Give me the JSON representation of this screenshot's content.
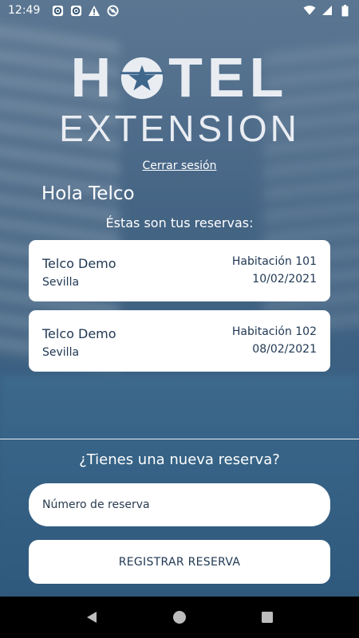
{
  "status_bar": {
    "time": "12:49",
    "left_icons": [
      "notification-icon",
      "notification-icon",
      "alert-icon",
      "do-not-disturb-icon"
    ],
    "right_icons": [
      "wifi-icon",
      "signal-icon",
      "battery-icon"
    ]
  },
  "logo": {
    "line1_part1": "H",
    "line1_part2": "TEL",
    "line2": "EXTENSION",
    "icon": "star-icon"
  },
  "logout_label": "Cerrar sesión",
  "greeting": "Hola Telco",
  "subtitle": "Éstas son tus reservas:",
  "reservations": [
    {
      "name": "Telco Demo",
      "city": "Sevilla",
      "room": "Habitación 101",
      "date": "10/02/2021"
    },
    {
      "name": "Telco Demo",
      "city": "Sevilla",
      "room": "Habitación 102",
      "date": "08/02/2021"
    }
  ],
  "new_reservation": {
    "question": "¿Tienes una nueva reserva?",
    "input_placeholder": "Número de reserva",
    "input_value": "",
    "button_label": "REGISTRAR RESERVA"
  },
  "nav_bar": {
    "back_icon": "back-icon",
    "home_icon": "home-icon",
    "recents_icon": "recents-icon"
  },
  "colors": {
    "card_text": "#1f3752",
    "logo_text": "#e9edf2",
    "background": "#4d7ea2"
  }
}
